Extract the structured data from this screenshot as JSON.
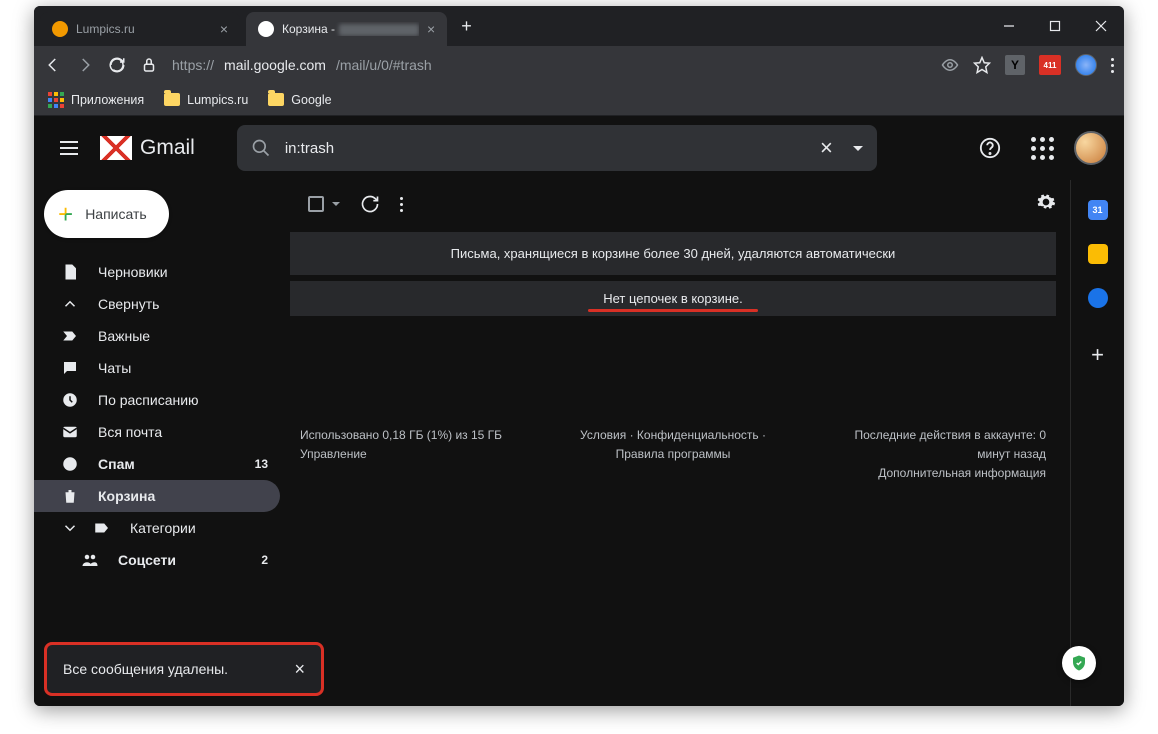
{
  "browser": {
    "tabs": [
      {
        "title": "Lumpics.ru",
        "active": false
      },
      {
        "title": "Корзина -",
        "active": true
      }
    ],
    "url_prefix": "https://",
    "url_host": "mail.google.com",
    "url_path": "/mail/u/0/#trash",
    "adblock_badge": "411",
    "bookmarks": {
      "apps": "Приложения",
      "lumpics": "Lumpics.ru",
      "google": "Google"
    }
  },
  "gmail": {
    "brand": "Gmail",
    "search_value": "in:trash",
    "compose": "Написать",
    "nav": {
      "drafts": "Черновики",
      "collapse": "Свернуть",
      "important": "Важные",
      "chats": "Чаты",
      "scheduled": "По расписанию",
      "allmail": "Вся почта",
      "spam": "Спам",
      "spam_count": "13",
      "trash": "Корзина",
      "categories": "Категории",
      "social": "Соцсети",
      "social_count": "2"
    },
    "banner": "Письма, хранящиеся в корзине более 30 дней, удаляются автоматически",
    "empty": "Нет цепочек в корзине.",
    "footer": {
      "storage_line1": "Использовано 0,18 ГБ (1%) из 15 ГБ",
      "storage_line2": "Управление",
      "legal": "Условия · Конфиденциальность · Правила программы",
      "activity_line1": "Последние действия в аккаунте: 0 минут назад",
      "activity_line2": "Дополнительная информация"
    },
    "rail_calendar_day": "31"
  },
  "toast": {
    "message": "Все сообщения удалены."
  }
}
